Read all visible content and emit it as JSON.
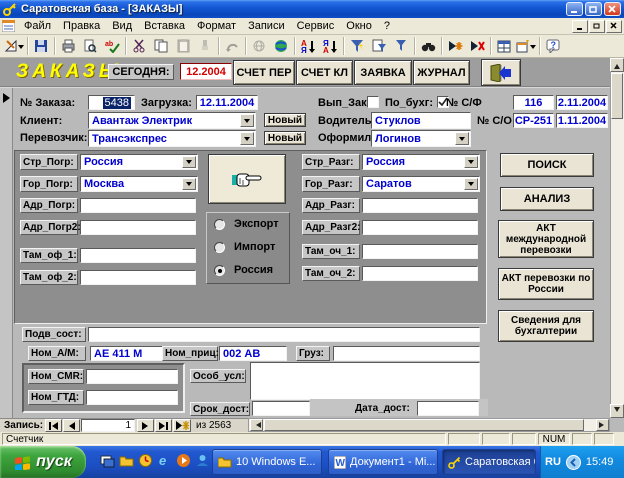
{
  "window": {
    "title": "Саратовская  база - [ЗАКАЗЫ]",
    "menu": [
      "Файл",
      "Правка",
      "Вид",
      "Вставка",
      "Формат",
      "Записи",
      "Сервис",
      "Окно",
      "?"
    ]
  },
  "header": {
    "form_title": "ЗАКАЗЫ",
    "today_label": "СЕГОДНЯ:",
    "today_value": "12.2004",
    "tab_schet_per": "СЧЕТ ПЕР",
    "tab_schet_kl": "СЧЕТ КЛ",
    "tab_zayavka": "ЗАЯВКА",
    "tab_zhurnal": "ЖУРНАЛ"
  },
  "order": {
    "order_label": "№ Заказа:",
    "order_no": "5438",
    "load_label": "Загрузка:",
    "load_date": "12.11.2004",
    "vyp_zak_label": "Вып_Зак:",
    "po_buhg_label": "По_бухг:",
    "sf_label": "№ С/Ф",
    "sf_no": "116",
    "sf_date": "2.11.2004",
    "client_label": "Клиент:",
    "client": "Авантаж Электрик",
    "new_button": "Новый",
    "driver_label": "Водитель:",
    "driver": "Стуклов",
    "so_label": "№ С/О",
    "so_no": "СР-251",
    "so_date": "1.11.2004",
    "carrier_label": "Перевозчик:",
    "carrier": "Трансэкспрес",
    "oformil_label": "Оформил:",
    "oformil": "Логинов"
  },
  "route": {
    "str_pogr_label": "Стр_Погр:",
    "str_pogr": "Россия",
    "gor_pogr_label": "Гор_Погр:",
    "gor_pogr": "Москва",
    "adr_pogr_label": "Адр_Погр:",
    "adr_pogr": "",
    "adr_pogr2_label": "Адр_Погр2:",
    "adr_pogr2": "",
    "tam_of1_label": "Там_оф_1:",
    "tam_of1": "",
    "tam_of2_label": "Там_оф_2:",
    "tam_of2": "",
    "str_razg_label": "Стр_Разг:",
    "str_razg": "Россия",
    "gor_razg_label": "Гор_Разг:",
    "gor_razg": "Саратов",
    "adr_razg_label": "Адр_Разг:",
    "adr_razg": "",
    "adr_razg2_label": "Адр_Разг2:",
    "adr_razg2": "",
    "tam_och1_label": "Там_оч_1:",
    "tam_och1": "",
    "tam_och2_label": "Там_оч_2:",
    "tam_och2": "",
    "radio_export": "Экспорт",
    "radio_import": "Импорт",
    "radio_russia": "Россия",
    "radio_selected": "Россия"
  },
  "side_buttons": {
    "search": "ПОИСК",
    "analysis": "АНАЛИЗ",
    "act_intl": "АКТ международной перевозки",
    "act_rus": "АКТ перевозки по России",
    "buh_info": "Сведения для бухгалтерии"
  },
  "cargo": {
    "podv_label": "Подв_сост:",
    "podv": "",
    "nom_am_label": "Ном_А/М:",
    "nom_am": "АЕ 411 М",
    "nom_pric_label": "Ном_приц:",
    "nom_pric": "002 АВ",
    "gruz_label": "Груз:",
    "gruz": "",
    "nom_smr_label": "Ном_СМR:",
    "nom_smr": "",
    "nom_gtd_label": "Ном_ГТД:",
    "nom_gtd": "",
    "osob_label": "Особ_усл:",
    "osob": "",
    "srok_label": "Срок_дост:",
    "srok": "",
    "data_label": "Дата_дост:",
    "data": ""
  },
  "record_nav": {
    "label": "Запись:",
    "current": "1",
    "of_total": "из 2563"
  },
  "status_bar": {
    "left": "Счетчик",
    "num": "NUM"
  },
  "taskbar": {
    "start": "пуск",
    "task1": "10 Windows E...",
    "task2": "Документ1 - Mi...",
    "task3": "Саратовская  б...",
    "lang": "RU",
    "time": "15:49"
  },
  "colors": {
    "accent_blue": "#0000d0",
    "alert_red": "#d40000",
    "title_yellow": "#ffff00"
  }
}
